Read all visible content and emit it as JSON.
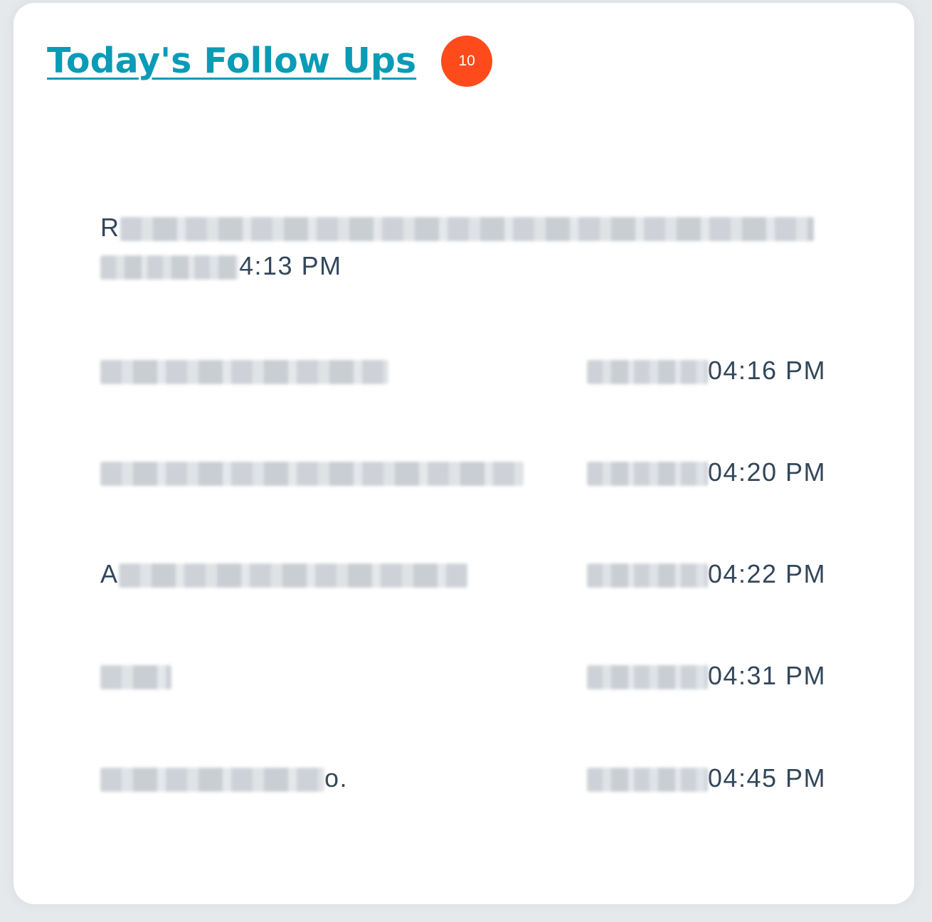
{
  "widget": {
    "title": "Today's Follow Ups",
    "count": "10"
  },
  "followups": [
    {
      "name_prefix": "R",
      "name_suffix": "",
      "time": "4:13 PM"
    },
    {
      "name_prefix": "",
      "name_suffix": "",
      "time": "04:16 PM"
    },
    {
      "name_prefix": "",
      "name_suffix": "",
      "time": "04:20 PM"
    },
    {
      "name_prefix": "A",
      "name_suffix": "",
      "time": "04:22 PM"
    },
    {
      "name_prefix": "",
      "name_suffix": "",
      "time": "04:31 PM"
    },
    {
      "name_prefix": "",
      "name_suffix": "o.",
      "time": "04:45 PM"
    }
  ],
  "colors": {
    "title": "#0a9bb6",
    "badge": "#ff4a1c",
    "text": "#33475b"
  }
}
